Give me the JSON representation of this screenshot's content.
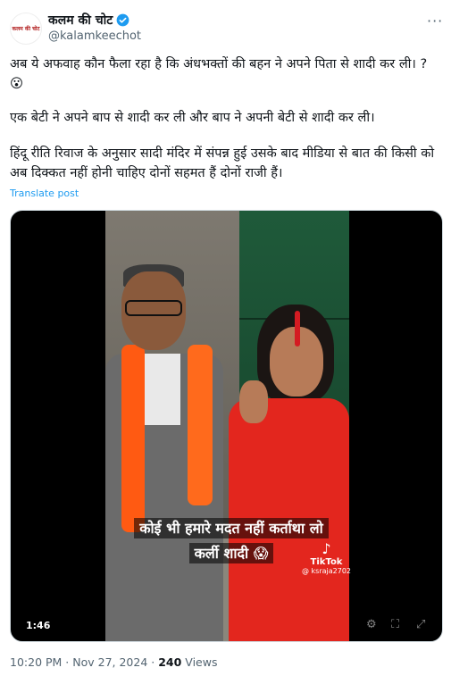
{
  "author": {
    "name": "कलम की चोट",
    "handle": "@kalamkeechot",
    "avatar_text": "कलम की चोट",
    "verified_color": "#1d9bf0"
  },
  "menu_icon": "more-options-icon",
  "tweet": {
    "line1": "अब ये अफवाह कौन फैला रहा है कि अंधभक्तों की बहन ने अपने पिता से शादी कर ली। ?",
    "emoji1": "😮",
    "line2": "एक बेटी ने अपने बाप से शादी कर ली और बाप ने अपनी बेटी से शादी कर ली।",
    "line3": "हिंदू रीति रिवाज के अनुसार सादी मंदिर में संपन्न हुई उसके बाद मीडिया से बात की किसी को अब दिक्कत नहीं होनी चाहिए दोनों सहमत हैं दोनों राजी हैं।"
  },
  "translate_label": "Translate post",
  "video": {
    "caption_line1": "कोई भी हमारे मदत नहीं कर्ताथा लो",
    "caption_line2": "कर्ली शादी 😱",
    "watermark": "TikTok",
    "watermark_handle": "@ ksraja2702",
    "duration": "1:46"
  },
  "footer": {
    "time": "10:20 PM",
    "separator": " · ",
    "date": "Nov 27, 2024",
    "views_count": "240",
    "views_label": "Views"
  }
}
